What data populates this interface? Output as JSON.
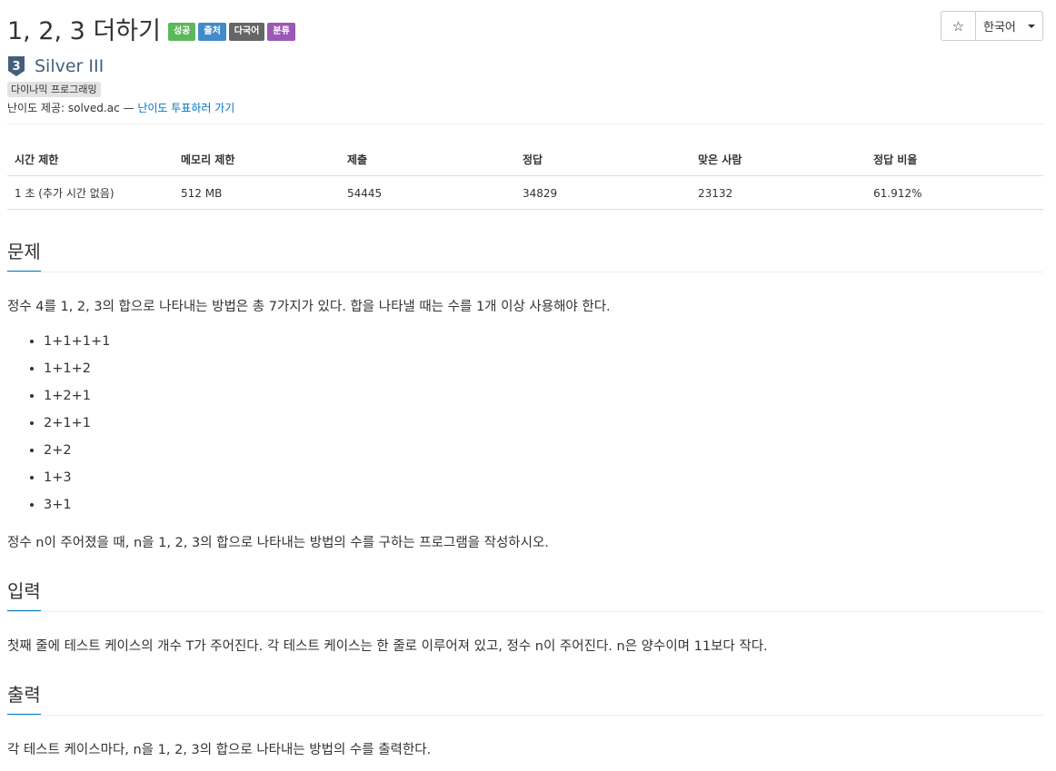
{
  "header": {
    "title": "1, 2, 3 더하기",
    "labels": [
      {
        "text": "성공",
        "color": "#5cb85c"
      },
      {
        "text": "출처",
        "color": "#428bca"
      },
      {
        "text": "다국어",
        "color": "#666666"
      },
      {
        "text": "분류",
        "color": "#9b59b6"
      }
    ],
    "star_glyph": "☆",
    "language_label": "한국어"
  },
  "tier": {
    "badge_text": "3",
    "name": "Silver III",
    "color": "#435f7a"
  },
  "tags": [
    "다이나믹 프로그래밍"
  ],
  "provider": {
    "prefix": "난이도 제공: solved.ac —",
    "link_text": "난이도 투표하러 가기"
  },
  "info_table": {
    "headers": [
      "시간 제한",
      "메모리 제한",
      "제출",
      "정답",
      "맞은 사람",
      "정답 비율"
    ],
    "row": [
      "1 초 (추가 시간 없음)",
      "512 MB",
      "54445",
      "34829",
      "23132",
      "61.912%"
    ]
  },
  "problem": {
    "heading": "문제",
    "intro": "정수 4를 1, 2, 3의 합으로 나타내는 방법은 총 7가지가 있다. 합을 나타낼 때는 수를 1개 이상 사용해야 한다.",
    "items": [
      "1+1+1+1",
      "1+1+2",
      "1+2+1",
      "2+1+1",
      "2+2",
      "1+3",
      "3+1"
    ],
    "outro": "정수 n이 주어졌을 때, n을 1, 2, 3의 합으로 나타내는 방법의 수를 구하는 프로그램을 작성하시오."
  },
  "input": {
    "heading": "입력",
    "text": "첫째 줄에 테스트 케이스의 개수 T가 주어진다. 각 테스트 케이스는 한 줄로 이루어져 있고, 정수 n이 주어진다. n은 양수이며 11보다 작다."
  },
  "output": {
    "heading": "출력",
    "text": "각 테스트 케이스마다, n을 1, 2, 3의 합으로 나타내는 방법의 수를 출력한다."
  },
  "colors": {
    "accent": "#0076c0",
    "text": "#333333"
  }
}
